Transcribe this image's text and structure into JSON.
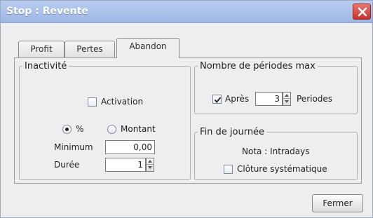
{
  "window": {
    "title": "Stop : Revente"
  },
  "tabs": [
    {
      "label": "Profit"
    },
    {
      "label": "Pertes"
    },
    {
      "label": "Abandon"
    }
  ],
  "inactivite": {
    "legend": "Inactivité",
    "activation": {
      "label": "Activation",
      "checked": false
    },
    "mode": {
      "percent_label": "%",
      "montant_label": "Montant",
      "selected": "%"
    },
    "minimum": {
      "label": "Minimum",
      "value": "0,00"
    },
    "duree": {
      "label": "Durée",
      "value": "1"
    }
  },
  "periodes": {
    "legend": "Nombre de périodes max",
    "apres": {
      "label": "Après",
      "checked": true
    },
    "value": "3",
    "unit": "Periodes"
  },
  "fin_journee": {
    "legend": "Fin de journée",
    "note": "Nota : Intradays",
    "cloture": {
      "label": "Clôture systématique",
      "checked": false
    }
  },
  "buttons": {
    "close": "Fermer"
  },
  "colors": {
    "titlebar": "#9db6e4",
    "close": "#c9302a",
    "background": "#eeeeee"
  }
}
